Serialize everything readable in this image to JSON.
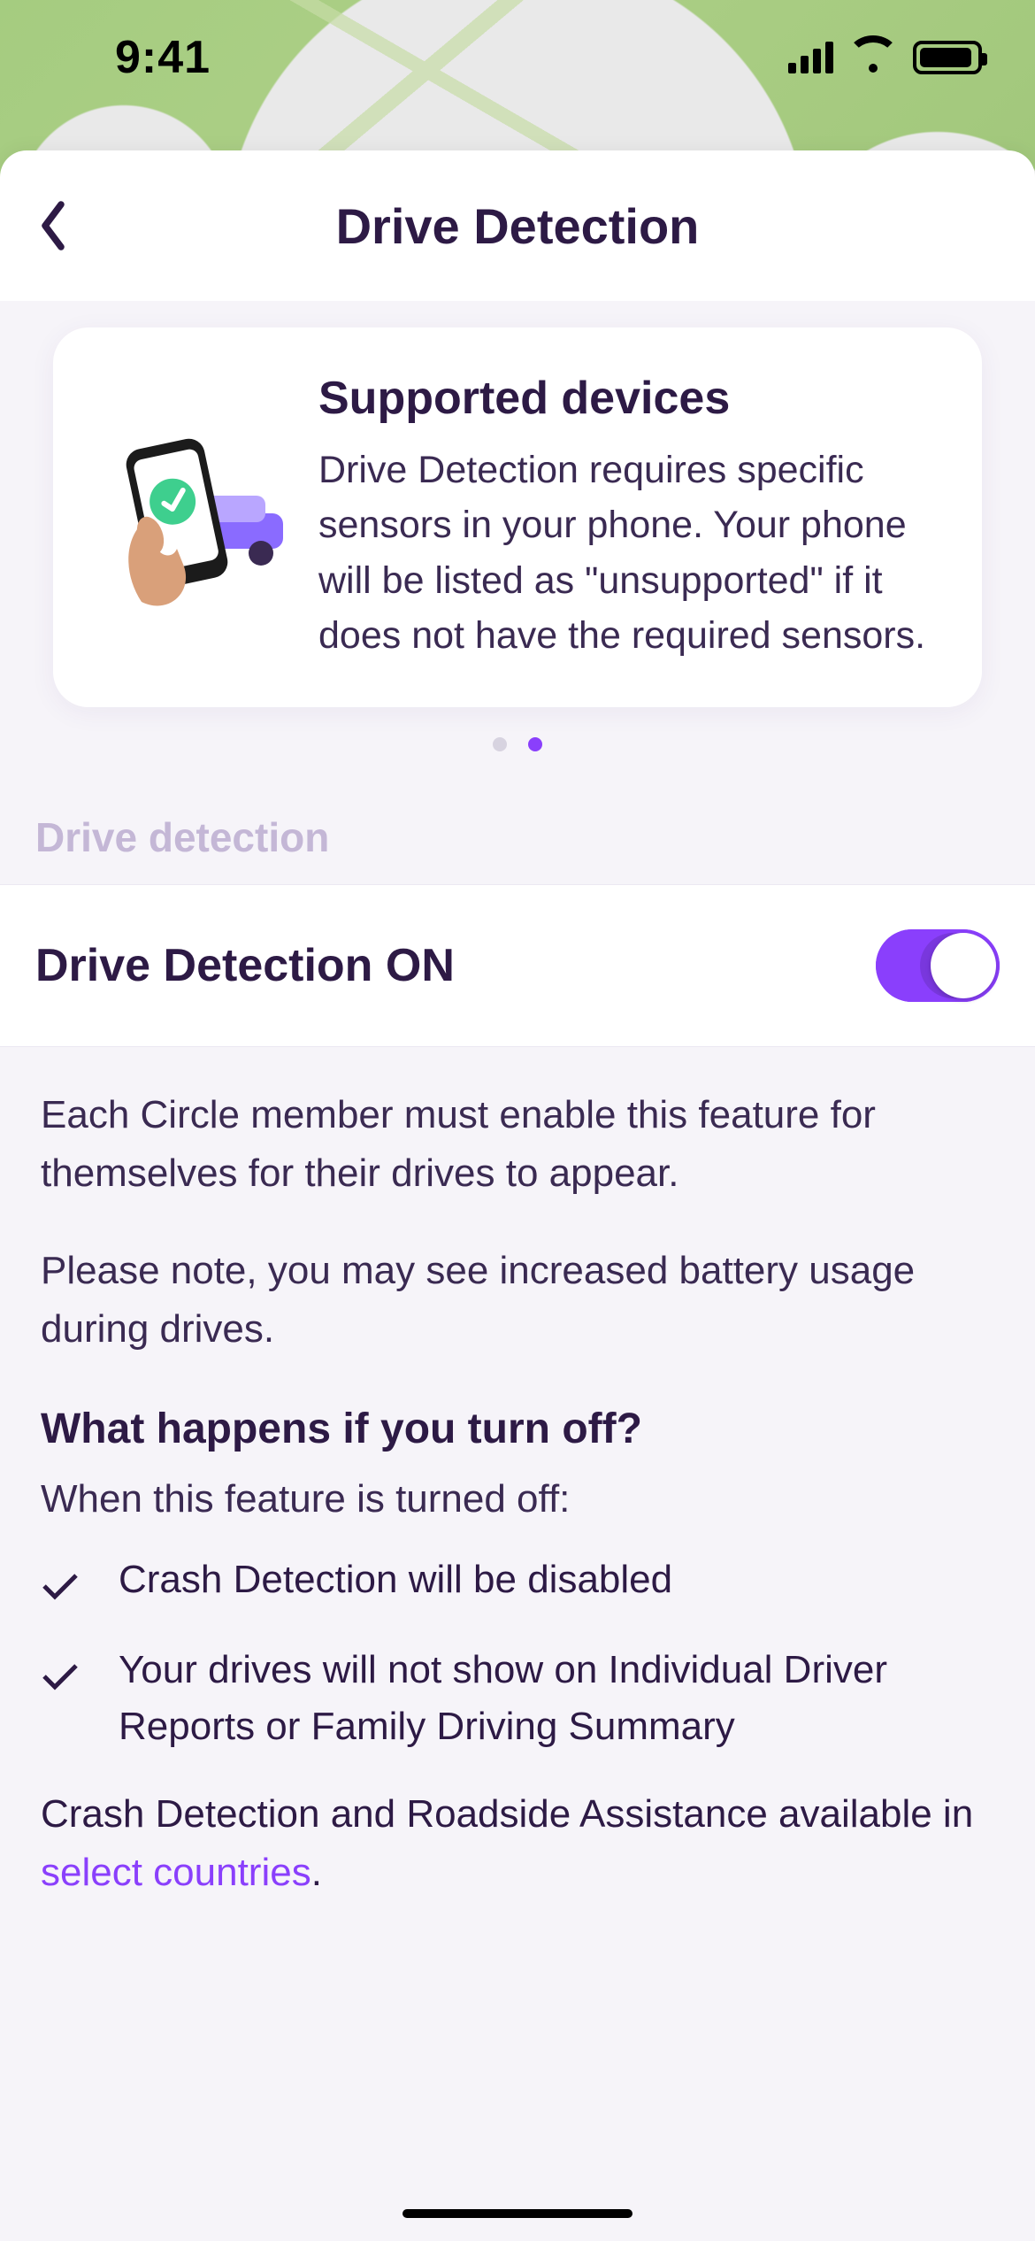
{
  "status": {
    "time": "9:41"
  },
  "header": {
    "title": "Drive Detection"
  },
  "card": {
    "title": "Supported devices",
    "body": "Drive Detection requires specific sensors in your phone. Your phone will be listed as \"unsupported\" if it does not have the required sensors."
  },
  "pager": {
    "count": 2,
    "active_index": 1
  },
  "section_label": "Drive detection",
  "toggle": {
    "label": "Drive Detection ON",
    "on": true
  },
  "info": {
    "p1": "Each Circle member must enable this feature for themselves for their drives to appear.",
    "p2": "Please note, you may see increased battery usage during drives.",
    "heading": "What happens if you turn off?",
    "subheading": "When this feature is turned off:",
    "items": [
      "Crash Detection will be disabled",
      "Your drives will not show on Individual Driver Reports or Family Driving Summary"
    ],
    "footer_prefix": "Crash Detection and Roadside Assistance available in ",
    "footer_link": "select countries",
    "footer_suffix": "."
  }
}
